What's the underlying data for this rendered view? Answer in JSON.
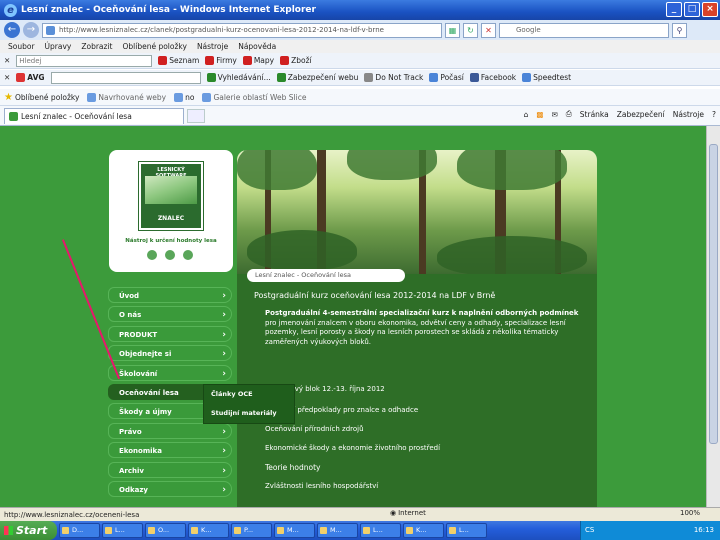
{
  "window": {
    "title": "Lesní znalec - Oceňování lesa - Windows Internet Explorer",
    "controls": [
      "_",
      "□",
      "×"
    ]
  },
  "address_bar": {
    "url": "http://www.lesniznalec.cz/clanek/postgradualni-kurz-ocenovani-lesa-2012-2014-na-ldf-v-brne",
    "search_placeholder": "Google"
  },
  "menu": [
    "Soubor",
    "Úpravy",
    "Zobrazit",
    "Oblíbené položky",
    "Nástroje",
    "Nápověda"
  ],
  "toolbar1": {
    "search_value": "Hledej",
    "items": [
      {
        "label": "Seznam",
        "color": "#d02020"
      },
      {
        "label": "Firmy",
        "color": "#d02020"
      },
      {
        "label": "Mapy",
        "color": "#d02020"
      },
      {
        "label": "Zboží",
        "color": "#d02020"
      }
    ]
  },
  "toolbar2": {
    "avg": "AVG",
    "items": [
      {
        "label": "Vyhledávání...",
        "color": "#2b8a2b"
      },
      {
        "label": "Zabezpečení webu",
        "color": "#2b8a2b"
      },
      {
        "label": "Do Not Track",
        "color": "#888888"
      },
      {
        "label": "Počasí",
        "color": "#4a84d8"
      },
      {
        "label": "Facebook",
        "color": "#3b5998"
      },
      {
        "label": "Speedtest",
        "color": "#4a84d8"
      }
    ]
  },
  "favorites_bar": {
    "label": "Oblíbené položky",
    "items": [
      "Navrhované weby",
      "no",
      "Galerie oblastí Web Slice"
    ]
  },
  "tab": {
    "title": "Lesní znalec - Oceňování lesa"
  },
  "command_bar": [
    "Stránka",
    "Zabezpečení",
    "Nástroje"
  ],
  "site": {
    "logo_top": "LESNICKÝ SOFTWARE",
    "logo_bottom": "ZNALEC",
    "logo_sub": "Nástroj k určení hodnoty lesa",
    "breadcrumb": "Lesní znalec - Oceňování lesa",
    "nav": [
      {
        "label": "Úvod"
      },
      {
        "label": "O nás"
      },
      {
        "label": "PRODUKT"
      },
      {
        "label": "Objednejte si"
      },
      {
        "label": "Školování"
      },
      {
        "label": "Oceňování lesa"
      },
      {
        "label": "Škody a újmy"
      },
      {
        "label": "Právo"
      },
      {
        "label": "Ekonomika"
      },
      {
        "label": "Archiv"
      },
      {
        "label": "Odkazy"
      }
    ],
    "submenu": [
      "Články OCE",
      "Studijní materiály"
    ],
    "content": {
      "title": "Postgraduální kurz oceňování lesa 2012-2014 na LDF v Brně",
      "lead_bold": "Postgraduální 4-semestrální specializační kurz k naplnění odborných podmínek",
      "lead_rest": "pro jmenování znalcem v oboru ekonomika, odvětví ceny a odhady, specializace lesní pozemky, lesní porosty a škody na lesních porostech se skládá z několika tématicky zaměřených výukových bloků.",
      "block": "1. výukový blok 12.-13. října 2012",
      "topics": [
        "Základní předpoklady pro znalce a odhadce",
        "Oceňování přírodních zdrojů",
        "Ekonomické škody a ekonomie životního prostředí",
        "Teorie hodnoty",
        "Zvláštnosti lesního hospodářství"
      ]
    }
  },
  "status_bar": {
    "url": "http://www.lesniznalec.cz/oceneni-lesa",
    "zone": "Internet",
    "zoom": "100%"
  },
  "taskbar": {
    "start": "Start",
    "tasks": [
      "D...",
      "L...",
      "O...",
      "K...",
      "P...",
      "M...",
      "M...",
      "L...",
      "K...",
      "L...",
      "CS"
    ],
    "clock": "16:13"
  }
}
